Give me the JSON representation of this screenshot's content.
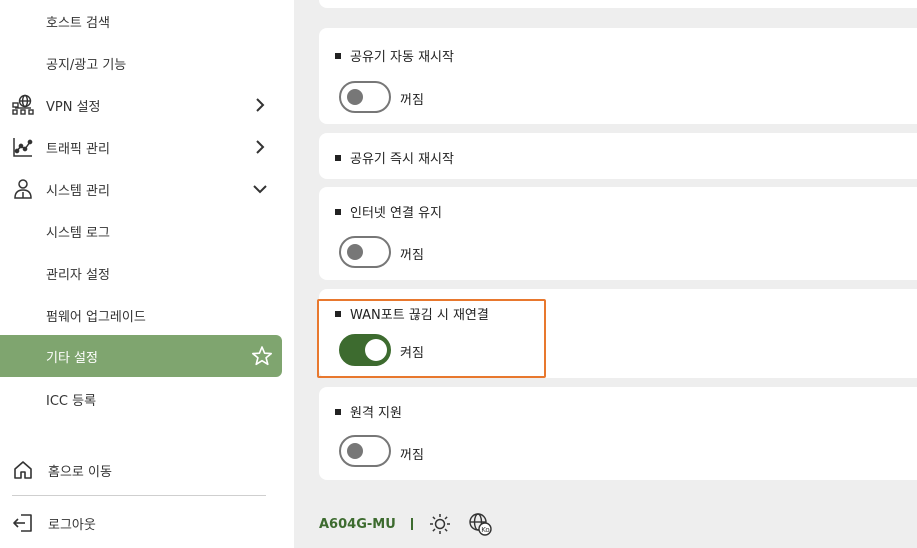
{
  "sidebar": {
    "items": [
      {
        "label": "호스트 검색"
      },
      {
        "label": "공지/광고 기능"
      },
      {
        "label": "VPN 설정"
      },
      {
        "label": "트래픽 관리"
      },
      {
        "label": "시스템 관리"
      },
      {
        "label": "시스템 로그"
      },
      {
        "label": "관리자 설정"
      },
      {
        "label": "펌웨어 업그레이드"
      },
      {
        "label": "기타 설정"
      },
      {
        "label": "ICC 등록"
      }
    ],
    "home": "홈으로 이동",
    "logout": "로그아웃"
  },
  "settings": [
    {
      "title": "공유기 자동 재시작",
      "toggle_label": "꺼짐",
      "on": false
    },
    {
      "title": "공유기 즉시 재시작"
    },
    {
      "title": "인터넷 연결 유지",
      "toggle_label": "꺼짐",
      "on": false
    },
    {
      "title": "WAN포트 끊김 시 재연결",
      "toggle_label": "켜짐",
      "on": true
    },
    {
      "title": "원격 지원",
      "toggle_label": "꺼짐",
      "on": false
    }
  ],
  "footer": {
    "model": "A604G-MU"
  },
  "colors": {
    "accent": "#7fa56f",
    "toggle_on": "#3d6b2f",
    "highlight": "#e8782e"
  }
}
